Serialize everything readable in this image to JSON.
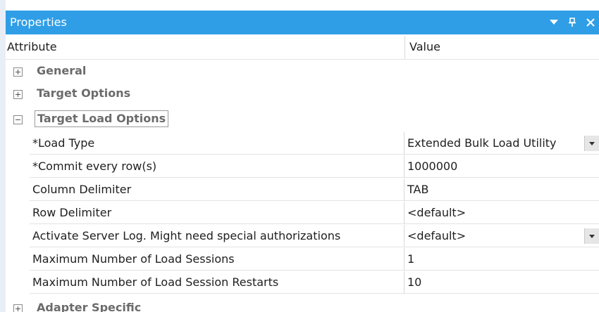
{
  "panel": {
    "title": "Properties",
    "title_icons": [
      "dropdown-arrow-icon",
      "pin-icon",
      "close-icon"
    ]
  },
  "grid": {
    "header": {
      "attribute": "Attribute",
      "value": "Value"
    },
    "groups": [
      {
        "label": "General",
        "expanded": false
      },
      {
        "label": "Target Options",
        "expanded": false
      },
      {
        "label": "Target Load Options",
        "expanded": true
      },
      {
        "label": "Adapter Specific",
        "expanded": false
      }
    ],
    "rows": [
      {
        "attribute": "*Load Type",
        "value": "Extended Bulk Load Utility",
        "has_dropdown": true
      },
      {
        "attribute": "*Commit every row(s)",
        "value": "1000000",
        "has_dropdown": false
      },
      {
        "attribute": "Column Delimiter",
        "value": "TAB",
        "has_dropdown": false
      },
      {
        "attribute": "Row Delimiter",
        "value": "<default>",
        "has_dropdown": false
      },
      {
        "attribute": "Activate Server Log. Might need special authorizations",
        "value": "<default>",
        "has_dropdown": true
      },
      {
        "attribute": "Maximum Number of Load Sessions",
        "value": "1",
        "has_dropdown": false
      },
      {
        "attribute": "Maximum Number of Load Session Restarts",
        "value": "10",
        "has_dropdown": false
      }
    ]
  },
  "colors": {
    "title_bar": "#2f9ee6",
    "group_text": "#6b6b6b",
    "grid_line": "#e3e3e3"
  }
}
